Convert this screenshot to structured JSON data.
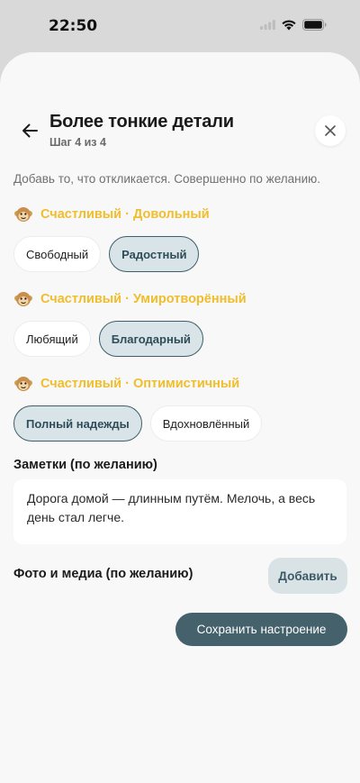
{
  "status_bar": {
    "time": "22:50"
  },
  "header": {
    "title": "Более тонкие детали",
    "step": "Шаг 4 из 4"
  },
  "intro": "Добавь то, что откликается. Совершенно по желанию.",
  "groups": [
    {
      "label": "Счастливый · Довольный",
      "chips": [
        {
          "label": "Свободный",
          "selected": false
        },
        {
          "label": "Радостный",
          "selected": true
        }
      ]
    },
    {
      "label": "Счастливый · Умиротворённый",
      "chips": [
        {
          "label": "Любящий",
          "selected": false
        },
        {
          "label": "Благодарный",
          "selected": true
        }
      ]
    },
    {
      "label": "Счастливый · Оптимистичный",
      "chips": [
        {
          "label": "Полный надежды",
          "selected": true
        },
        {
          "label": "Вдохновлённый",
          "selected": false
        }
      ]
    }
  ],
  "notes": {
    "label": "Заметки (по желанию)",
    "value": "Дорога домой — длинным путём. Мелочь, а весь день стал легче."
  },
  "media": {
    "label": "Фото и медиа (по желанию)",
    "add_label": "Добавить"
  },
  "save_label": "Сохранить настроение",
  "colors": {
    "accent": "#44616c",
    "group_title": "#f0bd2c",
    "chip_selected_bg": "#d9e4e8"
  },
  "icons": {
    "back": "arrow-left-icon",
    "close": "close-icon",
    "mood": "happy-face-icon"
  }
}
